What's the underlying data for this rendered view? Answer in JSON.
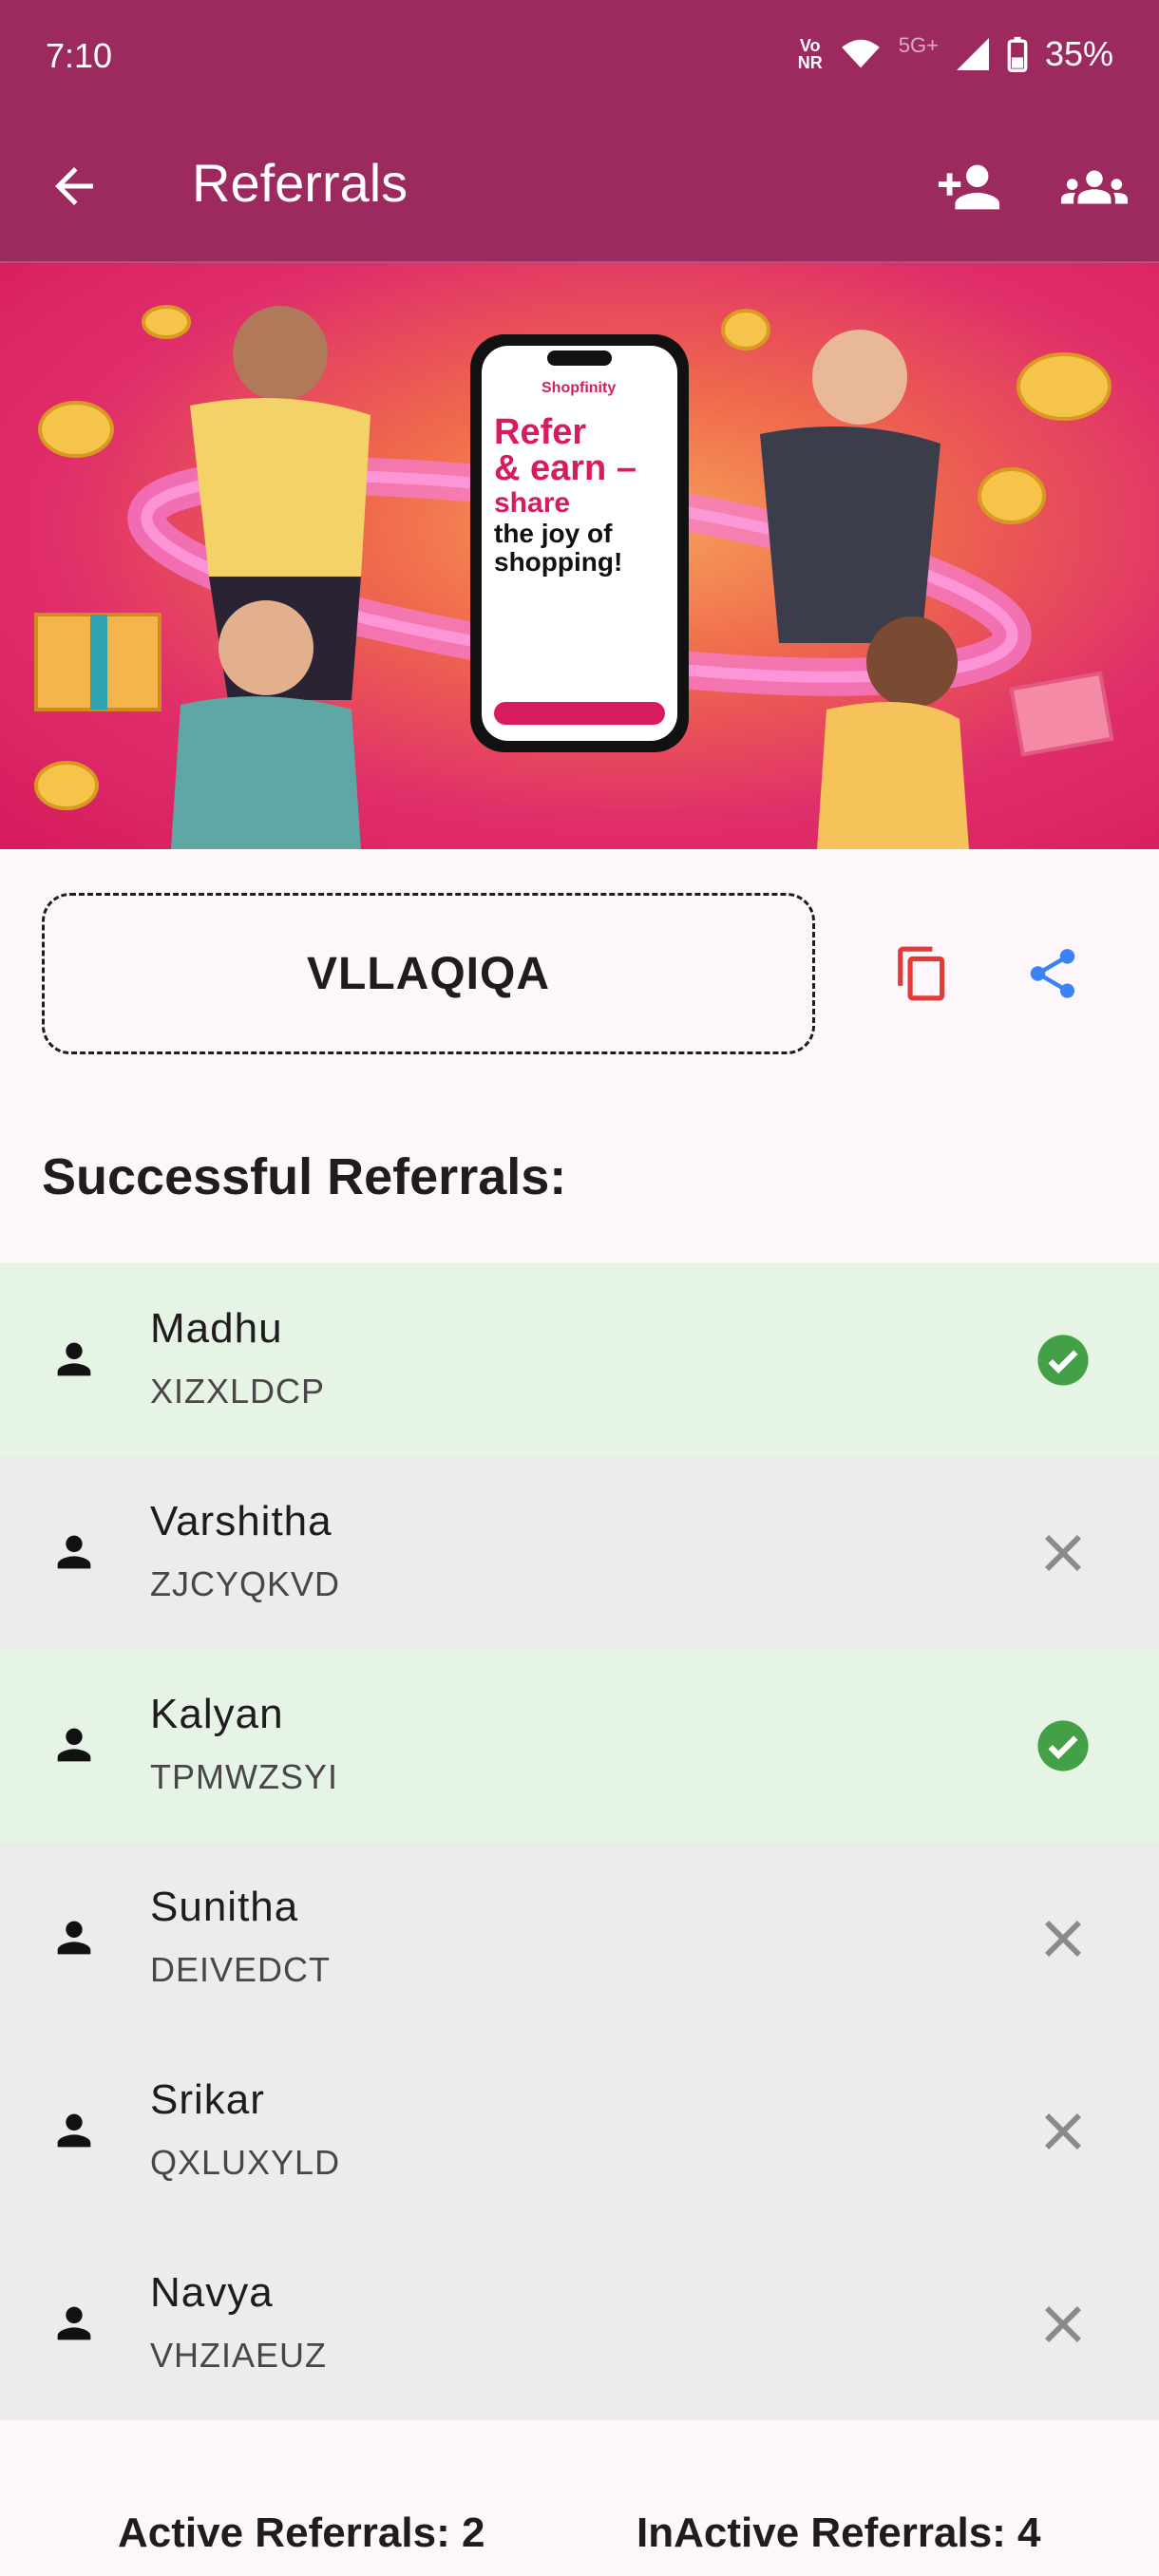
{
  "status_bar": {
    "time": "7:10",
    "network_label_top": "Vo",
    "network_label_bottom": "NR",
    "signal_label": "5G+",
    "battery": "35%"
  },
  "app_bar": {
    "title": "Referrals",
    "background": "#9c2a5f"
  },
  "banner": {
    "brand": "Shopfinity",
    "headline_1": "Refer",
    "headline_2": "& earn –",
    "headline_3": "share",
    "headline_4": "the joy of",
    "headline_5": "shopping!"
  },
  "referral": {
    "code": "VLLAQIQA",
    "copy_color": "#e53935",
    "share_color": "#3b82f6"
  },
  "section_title": "Successful Referrals:",
  "referrals": [
    {
      "name": "Madhu",
      "code": "XIZXLDCP",
      "status": "active"
    },
    {
      "name": "Varshitha",
      "code": "ZJCYQKVD",
      "status": "inactive"
    },
    {
      "name": "Kalyan",
      "code": "TPMWZSYI",
      "status": "active"
    },
    {
      "name": "Sunitha",
      "code": "DEIVEDCT",
      "status": "inactive"
    },
    {
      "name": "Srikar",
      "code": "QXLUXYLD",
      "status": "inactive"
    },
    {
      "name": "Navya",
      "code": "VHZIAEUZ",
      "status": "inactive"
    }
  ],
  "footer": {
    "active": "Active Referrals: 2",
    "inactive": "InActive Referrals: 4"
  }
}
